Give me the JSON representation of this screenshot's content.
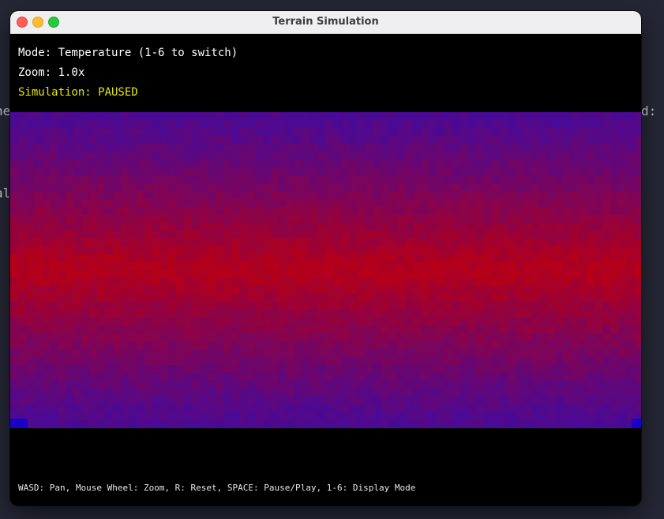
{
  "window": {
    "title": "Terrain Simulation"
  },
  "hud": {
    "mode": "Mode: Temperature (1-6 to switch)",
    "zoom": "Zoom: 1.0x",
    "simulation": "Simulation: PAUSED"
  },
  "help_text": "WASD: Pan, Mouse Wheel: Zoom, R: Reset, SPACE: Pause/Play, 1-6: Display Mode",
  "background_terminal": {
    "fragment_left_1": "he",
    "fragment_left_2": "al",
    "fragment_right_1": "d:"
  },
  "colors": {
    "desktop": "#252735",
    "hud_text": "#ffffff",
    "status_paused": "#e6e600",
    "map_cold": "#4a0a96",
    "map_hot": "#b4001a",
    "map_edge_blue": "#1a00c8"
  }
}
